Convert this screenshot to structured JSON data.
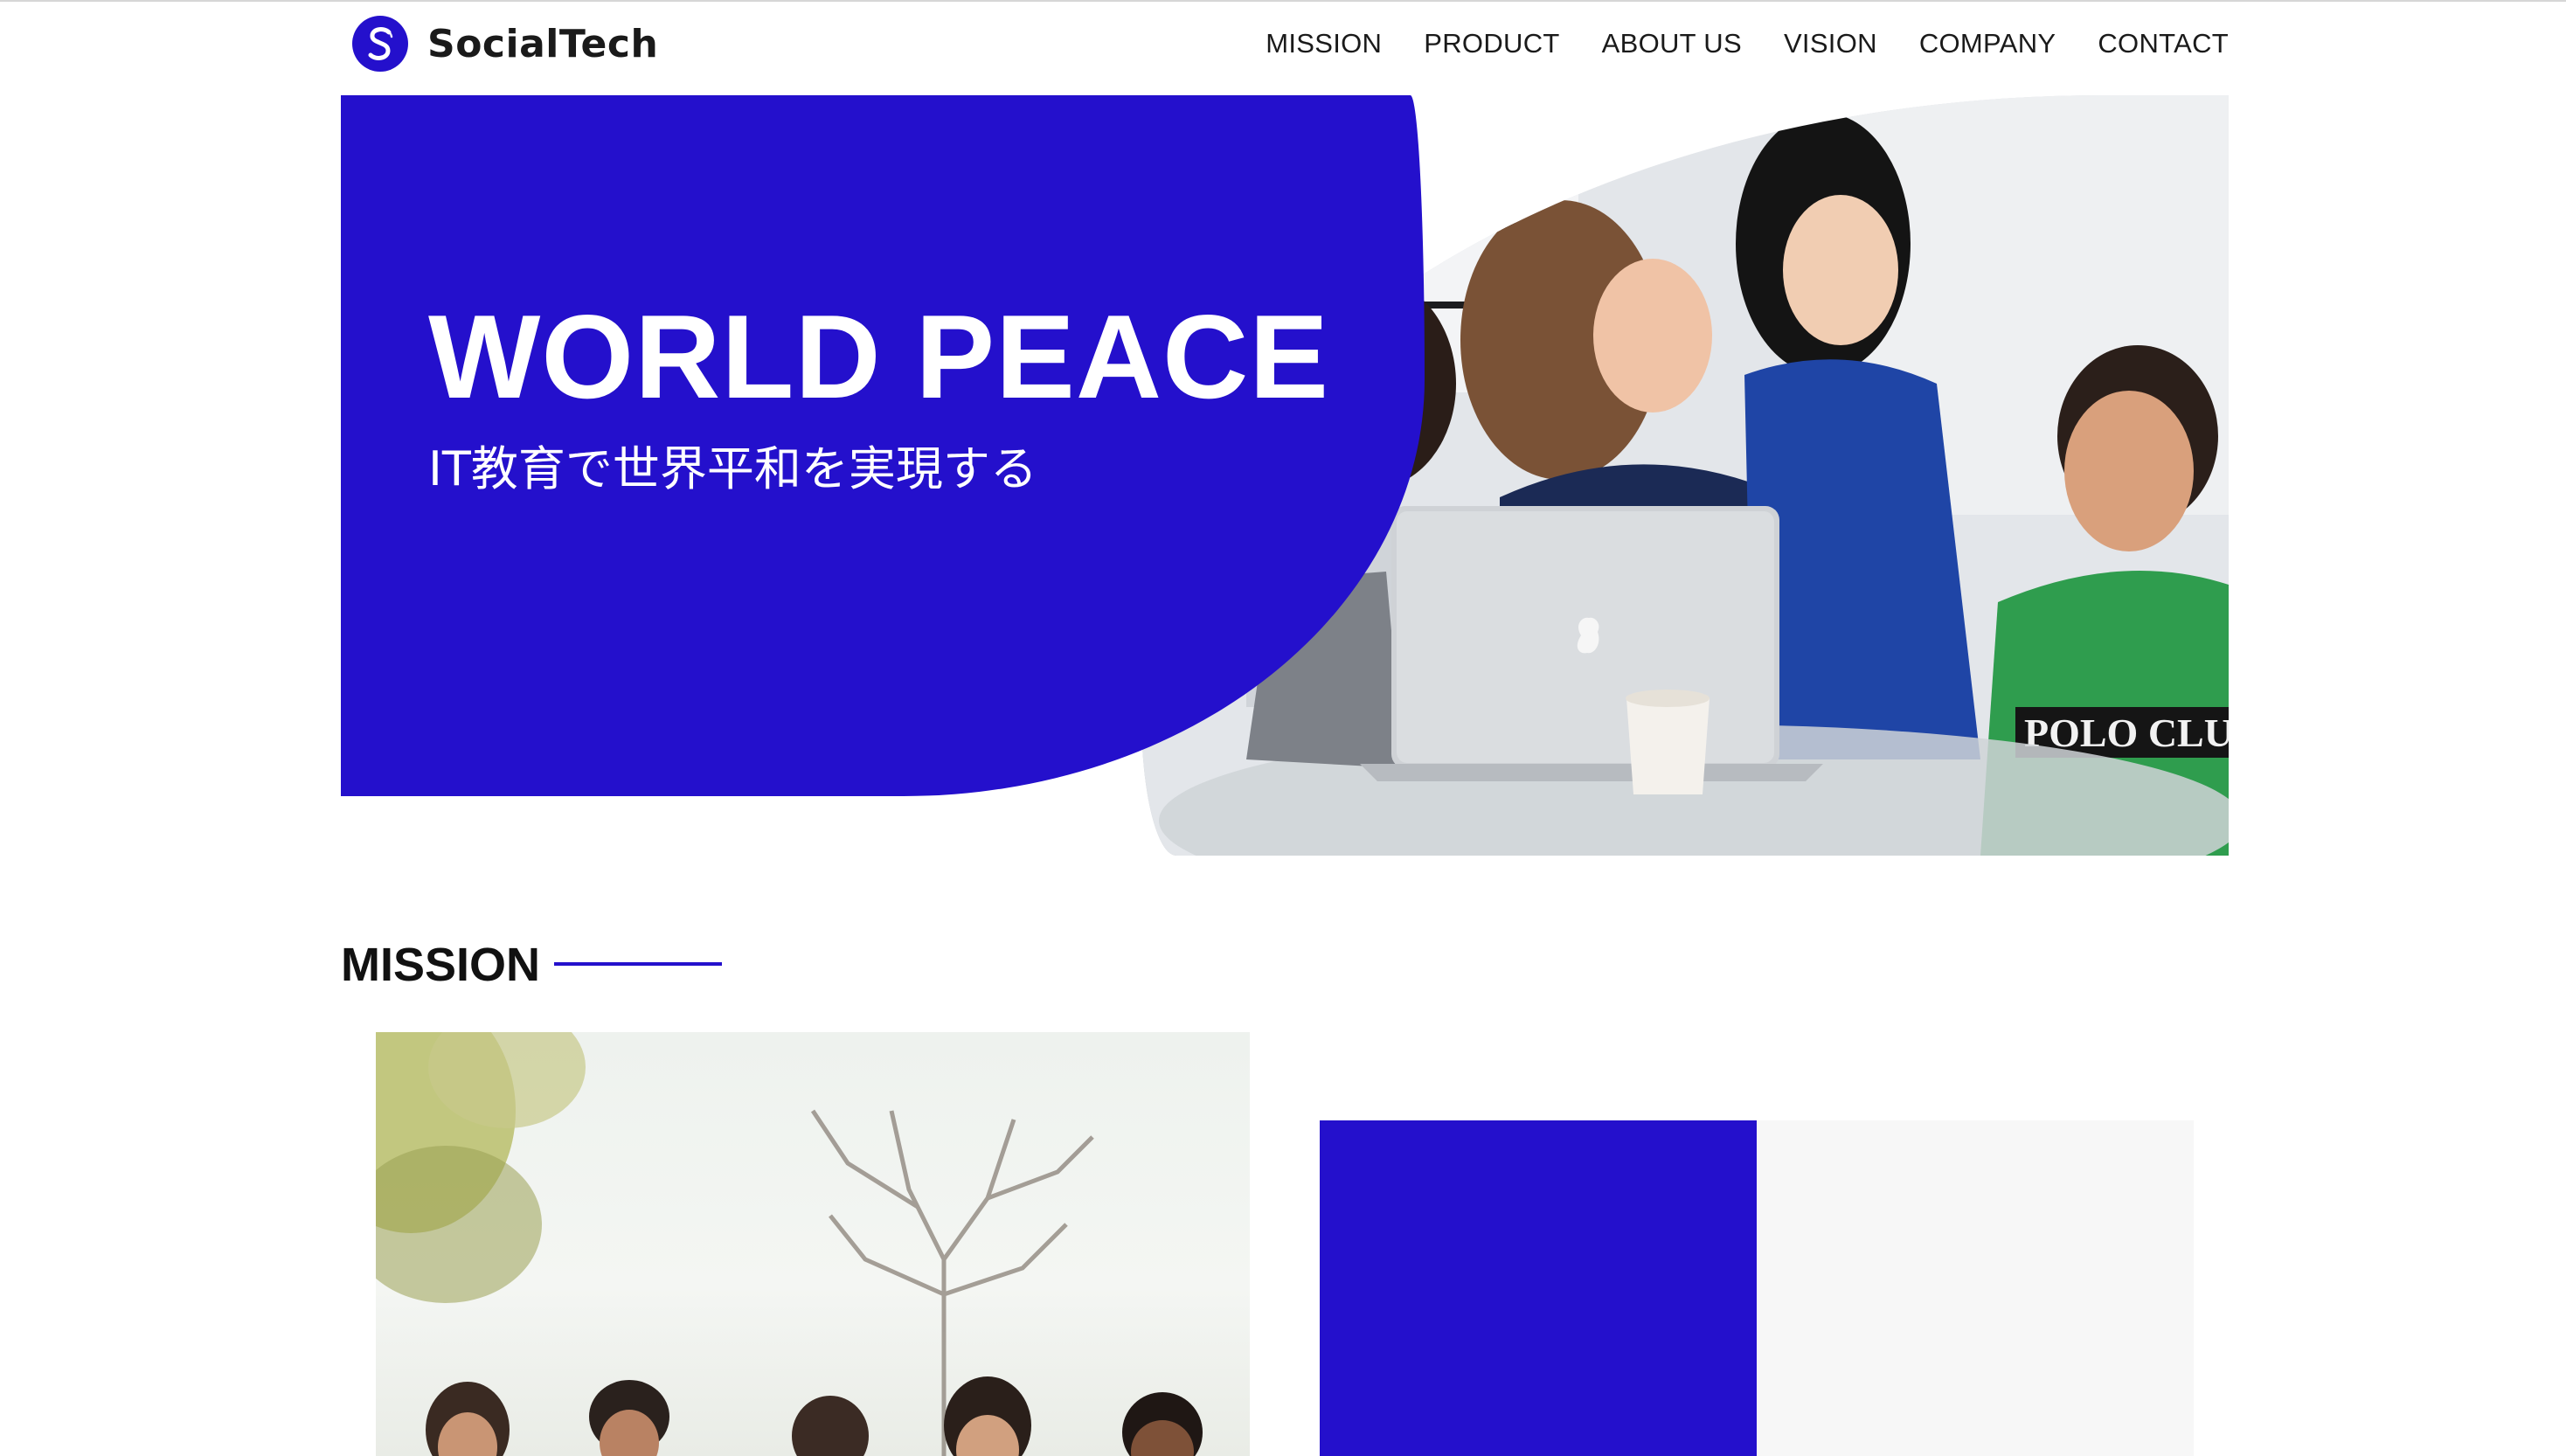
{
  "header": {
    "brand": "SocialTech",
    "logo_letter": "S",
    "nav": [
      "MISSION",
      "PRODUCT",
      "ABOUT US",
      "VISION",
      "COMPANY",
      "CONTACT"
    ]
  },
  "hero": {
    "title": "WORLD PEACE",
    "subtitle": "IT教育で世界平和を実現する",
    "shirt_text": "POLO CLUB"
  },
  "mission": {
    "heading": "MISSION"
  },
  "colors": {
    "accent": "#2410cc",
    "text": "#111111",
    "card_grey": "#f7f7f7"
  },
  "icons": {
    "logo": "s-circle-logo-icon",
    "laptop": "apple-laptop"
  }
}
